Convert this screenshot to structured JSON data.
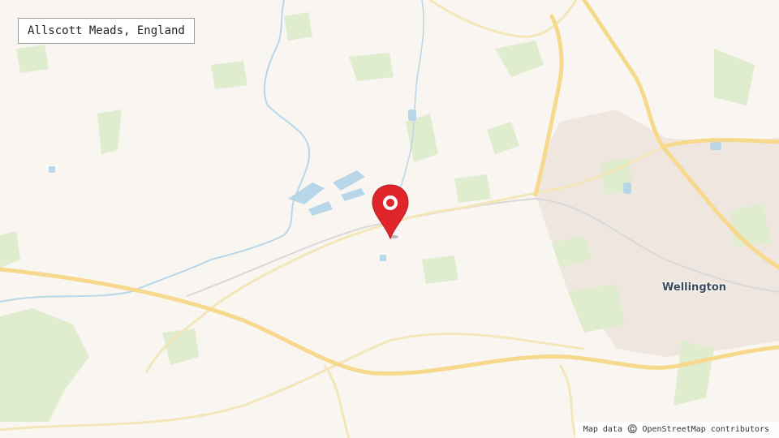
{
  "map": {
    "place_name": "Allscott Meads, England",
    "town_label": "Wellington",
    "attribution": "Map data ©️ OpenStreetMap contributors",
    "marker_icon": "location-pin-icon",
    "colors": {
      "land": "#f9f6f1",
      "woodland": "#dfeccd",
      "water": "#b7d7e8",
      "urban": "#efe7df",
      "motorway": "#f7d98d",
      "minor_road": "#f3e6b8",
      "railway": "#d9d9d9",
      "marker": "#e0262b"
    }
  }
}
